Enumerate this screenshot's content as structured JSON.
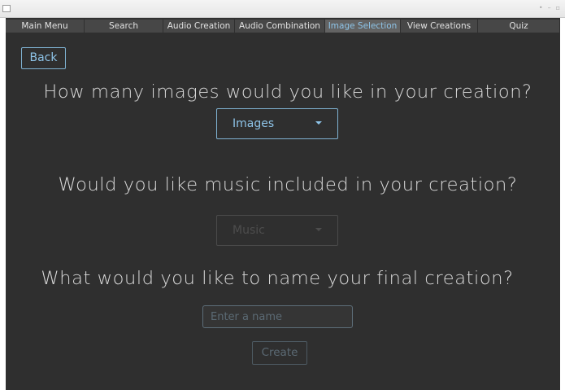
{
  "window": {
    "controls": [
      "•",
      "–",
      "▫"
    ]
  },
  "tabs": [
    {
      "label": "Main Menu",
      "active": false
    },
    {
      "label": "Search",
      "active": false
    },
    {
      "label": "Audio Creation",
      "active": false
    },
    {
      "label": "Audio Combination",
      "active": false
    },
    {
      "label": "Image Selection",
      "active": true
    },
    {
      "label": "View Creations",
      "active": false
    },
    {
      "label": "Quiz",
      "active": false
    }
  ],
  "back_label": "Back",
  "images_section": {
    "question": "How many images would you like in your creation?",
    "select_value": "Images",
    "enabled": true
  },
  "music_section": {
    "question": "Would you like music included in your creation?",
    "select_value": "Music",
    "enabled": false
  },
  "name_section": {
    "question": "What would you like to name your final creation?",
    "placeholder": "Enter a name",
    "value": ""
  },
  "create_label": "Create",
  "colors": {
    "background": "#2f2f2f",
    "accent": "#8ec4e8",
    "tab_bg": "#474747",
    "tab_active_bg": "#636363",
    "disabled": "#4d4d4d"
  }
}
